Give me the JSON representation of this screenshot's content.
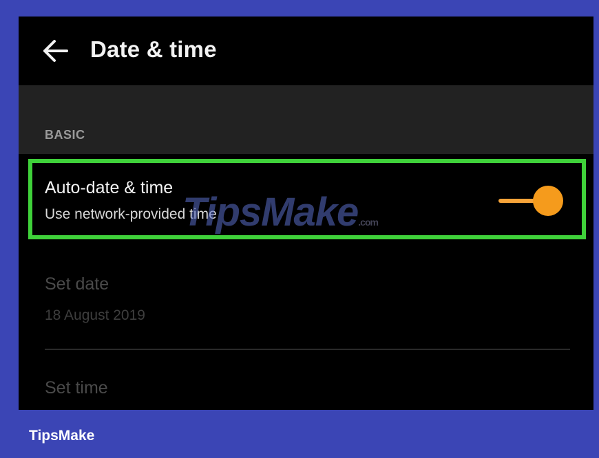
{
  "app_bar": {
    "back_icon": "arrow-left-icon",
    "title": "Date & time"
  },
  "section": {
    "header": "BASIC"
  },
  "settings": [
    {
      "title": "Auto-date & time",
      "subtitle": "Use network-provided time",
      "toggle_on": true,
      "enabled": true,
      "highlighted": true
    },
    {
      "title": "Set date",
      "subtitle": "18 August 2019",
      "enabled": false
    },
    {
      "title": "Set time",
      "enabled": false
    }
  ],
  "watermark": {
    "text": "TipsMake",
    "suffix": ".com"
  },
  "footer": {
    "brand": "TipsMake"
  },
  "colors": {
    "frame": "#3b45b5",
    "highlight": "#3fd13a",
    "toggle_accent": "#f59b1c",
    "screen_background": "#000000"
  }
}
